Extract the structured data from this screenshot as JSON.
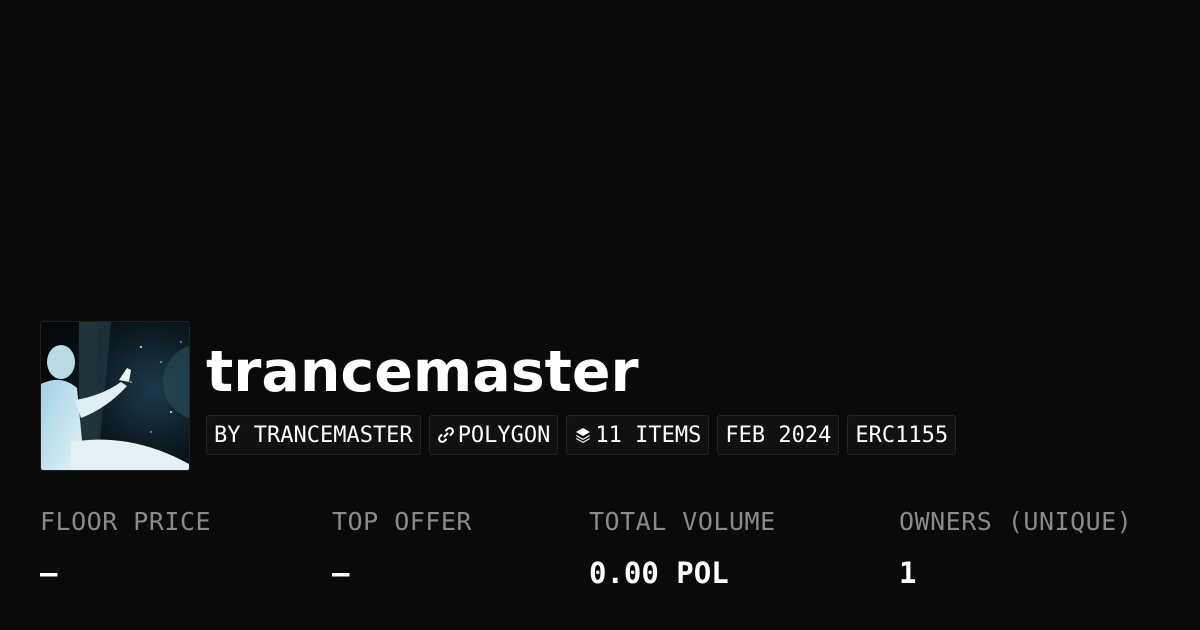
{
  "collection": {
    "name": "trancemaster",
    "tags": {
      "creator": "BY TRANCEMASTER",
      "chain": "POLYGON",
      "items": "11 ITEMS",
      "date": "FEB 2024",
      "standard": "ERC1155"
    },
    "icons": {
      "chain": "link-icon",
      "items": "layers-icon"
    }
  },
  "stats": {
    "floor_price": {
      "label": "FLOOR PRICE",
      "value": "–"
    },
    "top_offer": {
      "label": "TOP OFFER",
      "value": "–"
    },
    "total_volume": {
      "label": "TOTAL VOLUME",
      "value": "0.00 POL"
    },
    "owners": {
      "label": "OWNERS (UNIQUE)",
      "value": "1"
    }
  },
  "colors": {
    "background": "#0a0a0a",
    "text": "#ffffff",
    "muted": "#8a8a8a",
    "tag_border": "#262626"
  }
}
